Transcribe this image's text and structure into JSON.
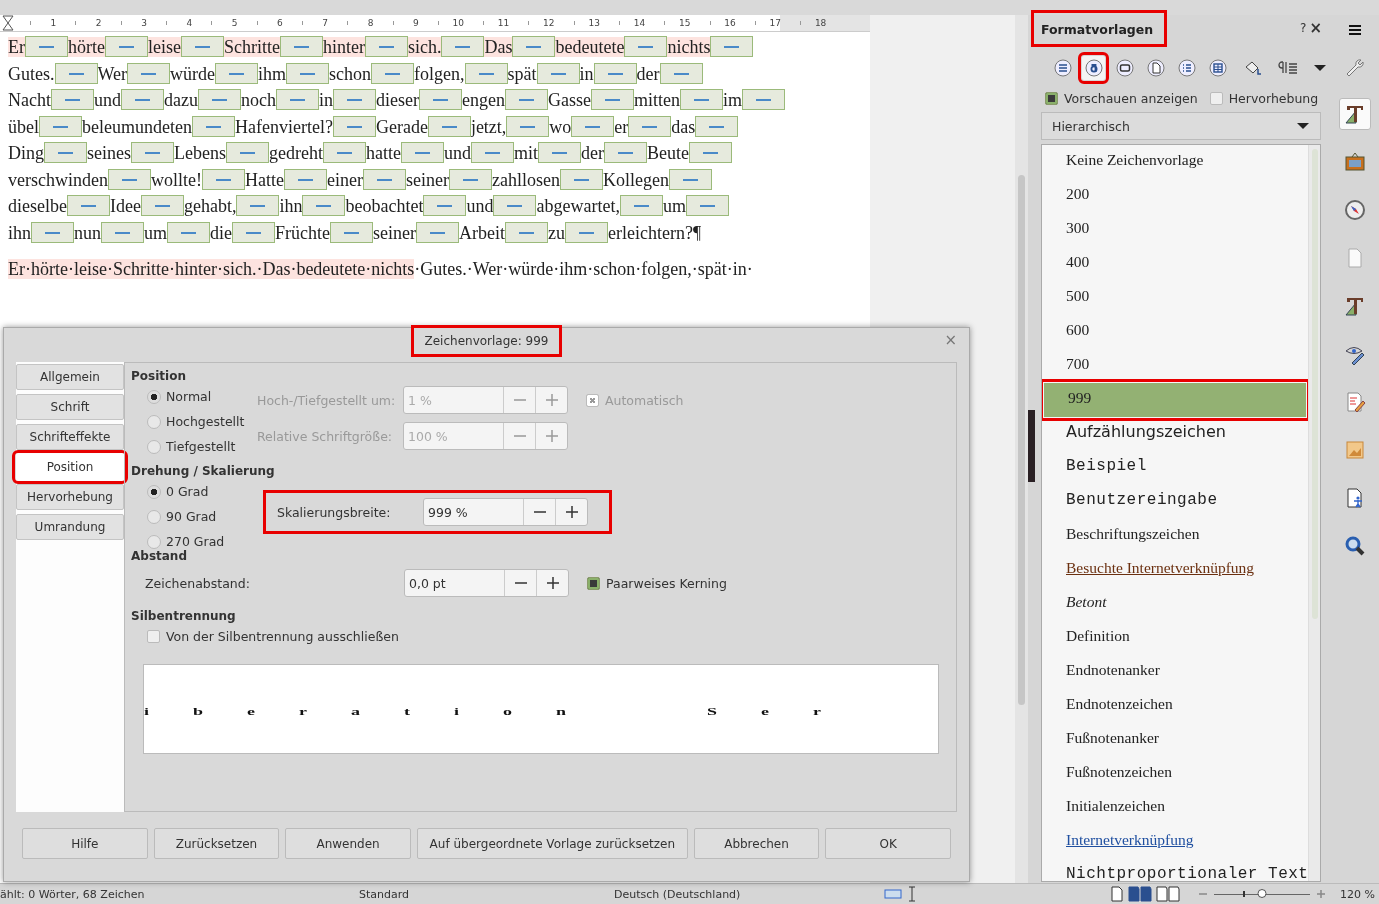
{
  "ruler": {
    "marks": [
      "1",
      "2",
      "3",
      "4",
      "5",
      "6",
      "7",
      "8",
      "9",
      "10",
      "11",
      "12",
      "13",
      "14",
      "15",
      "16",
      "17",
      "18"
    ]
  },
  "document": {
    "paragraph_1": {
      "styled": "Er hörte leise Schritte hinter sich. Das bedeutete nichts",
      "rest": "Gutes. Wer würde ihm schon folgen, spät in der Nacht und dazu noch in dieser engen Gasse mitten im übel beleumundeten Hafenviertel? Gerade jetzt, wo er das Ding seines Lebens gedreht hatte und mit der Beute verschwinden wollte! Hatte einer seiner zahllosen Kollegen dieselbe Idee gehabt, ihn beobachtet und abgewartet, um ihn nun um die Früchte seiner Arbeit zu erleichtern?¶"
    },
    "paragraph_2": {
      "styled": "Er·hörte·leise·Schritte·hinter·sich.·Das·bedeutete·nichts",
      "rest": "·Gutes.·Wer·würde·ihm·schon·folgen,·spät·in·"
    }
  },
  "dialog": {
    "title": "Zeichenvorlage: 999",
    "title_highlighted": true,
    "close": "×",
    "tabs": [
      {
        "label": "Allgemein",
        "selected": false,
        "highlighted": false
      },
      {
        "label": "Schrift",
        "selected": false,
        "highlighted": false
      },
      {
        "label": "Schrifteffekte",
        "selected": false,
        "highlighted": false
      },
      {
        "label": "Position",
        "selected": true,
        "highlighted": true
      },
      {
        "label": "Hervorhebung",
        "selected": false,
        "highlighted": false
      },
      {
        "label": "Umrandung",
        "selected": false,
        "highlighted": false
      }
    ],
    "position": {
      "heading": "Position",
      "options": [
        {
          "label": "Normal",
          "selected": true
        },
        {
          "label": "Hochgestellt",
          "selected": false
        },
        {
          "label": "Tiefgestellt",
          "selected": false
        }
      ],
      "fields": [
        {
          "label": "Hoch-/Tiefgestellt um:",
          "value": "1 %",
          "disabled": true
        },
        {
          "label": "Relative Schriftgröße:",
          "value": "100 %",
          "disabled": true
        }
      ],
      "automatic": {
        "label": "Automatisch",
        "checked": true,
        "disabled": true
      }
    },
    "rotation": {
      "heading": "Drehung / Skalierung",
      "options": [
        {
          "label": "0 Grad",
          "selected": true
        },
        {
          "label": "90 Grad",
          "selected": false
        },
        {
          "label": "270 Grad",
          "selected": false
        }
      ],
      "scale_field": {
        "label": "Skalierungsbreite:",
        "value": "999 %",
        "disabled": false,
        "highlighted": true
      }
    },
    "spacing": {
      "heading": "Abstand",
      "field": {
        "label": "Zeichenabstand:",
        "value": "0,0 pt",
        "disabled": false
      },
      "kerning": {
        "label": "Paarweises Kerning",
        "checked": true,
        "disabled": false
      }
    },
    "hyphenation": {
      "heading": "Silbentrennung",
      "exclude": {
        "label": "Von der Silbentrennung ausschließen",
        "checked": false,
        "disabled": false
      }
    },
    "preview": "iberation  Ser",
    "buttons": [
      "Hilfe",
      "Zurücksetzen",
      "Anwenden",
      "Auf übergeordnete Vorlage zurücksetzen",
      "Abbrechen",
      "OK"
    ]
  },
  "sidebar": {
    "title": "Formatvorlagen",
    "title_highlighted": true,
    "help": "?",
    "close": "×",
    "families": [
      {
        "selected": false,
        "highlighted": false
      },
      {
        "selected": true,
        "highlighted": true
      },
      {
        "selected": false,
        "highlighted": false
      },
      {
        "selected": false,
        "highlighted": false
      },
      {
        "selected": false,
        "highlighted": false
      },
      {
        "selected": false,
        "highlighted": false
      }
    ],
    "show_previews": {
      "label": "Vorschauen anzeigen",
      "checked": true
    },
    "spotlight": {
      "label": "Hervorhebung",
      "checked": false
    },
    "filter": "Hierarchisch",
    "styles": [
      {
        "name": "Keine Zeichenvorlage",
        "kind": "serif",
        "selected": false,
        "highlighted": false
      },
      {
        "name": "200",
        "kind": "serif",
        "selected": false,
        "highlighted": false
      },
      {
        "name": "300",
        "kind": "serif",
        "selected": false,
        "highlighted": false
      },
      {
        "name": "400",
        "kind": "serif",
        "selected": false,
        "highlighted": false
      },
      {
        "name": "500",
        "kind": "serif",
        "selected": false,
        "highlighted": false
      },
      {
        "name": "600",
        "kind": "serif",
        "selected": false,
        "highlighted": false
      },
      {
        "name": "700",
        "kind": "serif",
        "selected": false,
        "highlighted": false
      },
      {
        "name": "999",
        "kind": "serif",
        "selected": true,
        "highlighted": true
      },
      {
        "name": "Aufzählungszeichen",
        "kind": "sans",
        "selected": false,
        "highlighted": false
      },
      {
        "name": "Beispiel",
        "kind": "mono",
        "selected": false,
        "highlighted": false
      },
      {
        "name": "Benutzereingabe",
        "kind": "mono",
        "selected": false,
        "highlighted": false
      },
      {
        "name": "Beschriftungszeichen",
        "kind": "serif",
        "selected": false,
        "highlighted": false
      },
      {
        "name": "Besuchte Internetverknüpfung",
        "kind": "visited",
        "selected": false,
        "highlighted": false
      },
      {
        "name": "Betont",
        "kind": "italic",
        "selected": false,
        "highlighted": false
      },
      {
        "name": "Definition",
        "kind": "serif",
        "selected": false,
        "highlighted": false
      },
      {
        "name": "Endnotenanker",
        "kind": "serif",
        "selected": false,
        "highlighted": false
      },
      {
        "name": "Endnotenzeichen",
        "kind": "serif",
        "selected": false,
        "highlighted": false
      },
      {
        "name": "Fußnotenanker",
        "kind": "serif",
        "selected": false,
        "highlighted": false
      },
      {
        "name": "Fußnotenzeichen",
        "kind": "serif",
        "selected": false,
        "highlighted": false
      },
      {
        "name": "Initialenzeichen",
        "kind": "serif",
        "selected": false,
        "highlighted": false
      },
      {
        "name": "Internetverknüpfung",
        "kind": "link",
        "selected": false,
        "highlighted": false
      },
      {
        "name": "Nichtproportionaler Text",
        "kind": "mono",
        "selected": false,
        "highlighted": false
      }
    ]
  },
  "deck": [
    {
      "selected": false
    },
    {
      "selected": true
    },
    {
      "selected": false
    },
    {
      "selected": false
    },
    {
      "selected": false
    },
    {
      "selected": false
    },
    {
      "selected": false
    },
    {
      "selected": false
    },
    {
      "selected": false
    },
    {
      "selected": false
    },
    {
      "selected": false
    }
  ],
  "status_bar": {
    "word_count": "ählt: 0 Wörter, 68 Zeichen",
    "page_style": "Standard",
    "language": "Deutsch (Deutschland)",
    "views": [
      {
        "selected": false
      },
      {
        "selected": true
      },
      {
        "selected": false
      }
    ],
    "zoom": {
      "level": 0.5,
      "reading": "120 %"
    }
  }
}
